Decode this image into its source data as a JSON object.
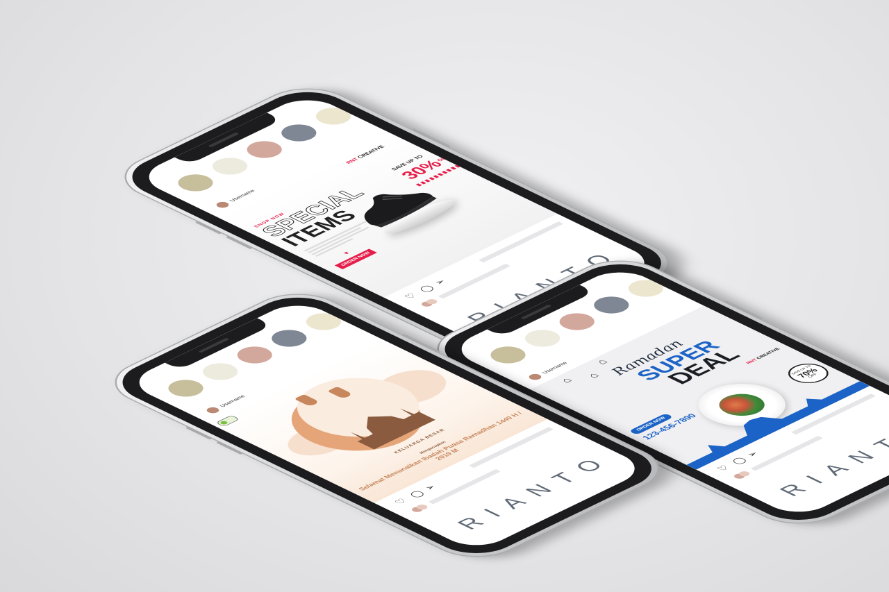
{
  "scene": {
    "background": "#e6e6e8",
    "phone_color": "#d0d1d3",
    "brand_color": "#606a76"
  },
  "palette": {
    "colors": [
      "#c7bf9c",
      "#ecebde",
      "#d3a89c",
      "#7f8694",
      "#ece6cf"
    ]
  },
  "phones": [
    {
      "username": "Username",
      "brand": "RIANTO",
      "post": {
        "logo_prefix": "RNT",
        "logo_name": "CREATIVE",
        "kicker": "SHOP NOW",
        "headline_1": "SPECIAL",
        "headline_2": "ITEMS",
        "cta": "ORDER NOW",
        "save_label": "SAVE UP TO",
        "discount": "30%",
        "discount_suffix": "OFF"
      }
    },
    {
      "username": "Username",
      "brand": "RIANTO",
      "post": {
        "script_title": "Ramadan",
        "headline_1": "SUPER",
        "headline_2": "DEAL",
        "logo_prefix": "RNT",
        "logo_name": "CREATIVE",
        "pill": "ORDER NOW",
        "phone_number": "123-456-7890",
        "badge_top": "SAVE UP TO",
        "badge_value": "70%",
        "badge_bottom": "OFF"
      }
    },
    {
      "username": "Username",
      "brand": "RIANTO",
      "post": {
        "line_1": "KELUARGA BESAR",
        "line_3": "Mengucapkan",
        "line_4": "Selamat Menunaikan Ibadah Puasa Ramadhan 1440 H / 2019 M"
      }
    }
  ]
}
